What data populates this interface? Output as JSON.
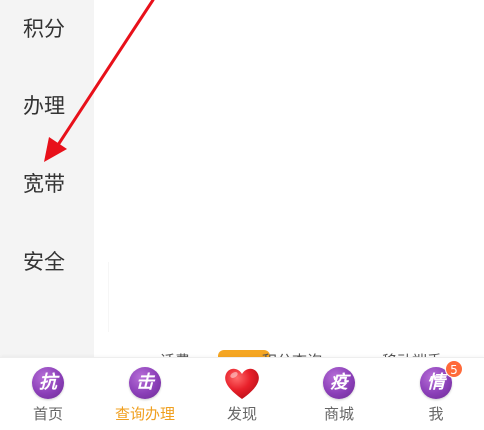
{
  "sidebar": {
    "items": [
      {
        "label": "积分"
      },
      {
        "label": "办理"
      },
      {
        "label": "宽带"
      },
      {
        "label": "安全"
      }
    ]
  },
  "partial_strip": {
    "items": [
      "话费",
      "积分查询",
      "移动端手"
    ]
  },
  "tabbar": {
    "tabs": [
      {
        "icon_char": "抗",
        "label": "首页"
      },
      {
        "icon_char": "击",
        "label": "查询办理"
      },
      {
        "icon_name": "heart-icon",
        "label": "发现"
      },
      {
        "icon_char": "疫",
        "label": "商城"
      },
      {
        "icon_char": "情",
        "label": "我",
        "badge": "5"
      }
    ],
    "active_index": 1
  },
  "colors": {
    "sidebar_bg": "#f4f4f4",
    "active_label": "#f0a020",
    "icon_purple": "#8b3fb8",
    "heart_red": "#e8202a",
    "badge_orange": "#ff6a3a",
    "annotation_arrow": "#e8101a"
  }
}
